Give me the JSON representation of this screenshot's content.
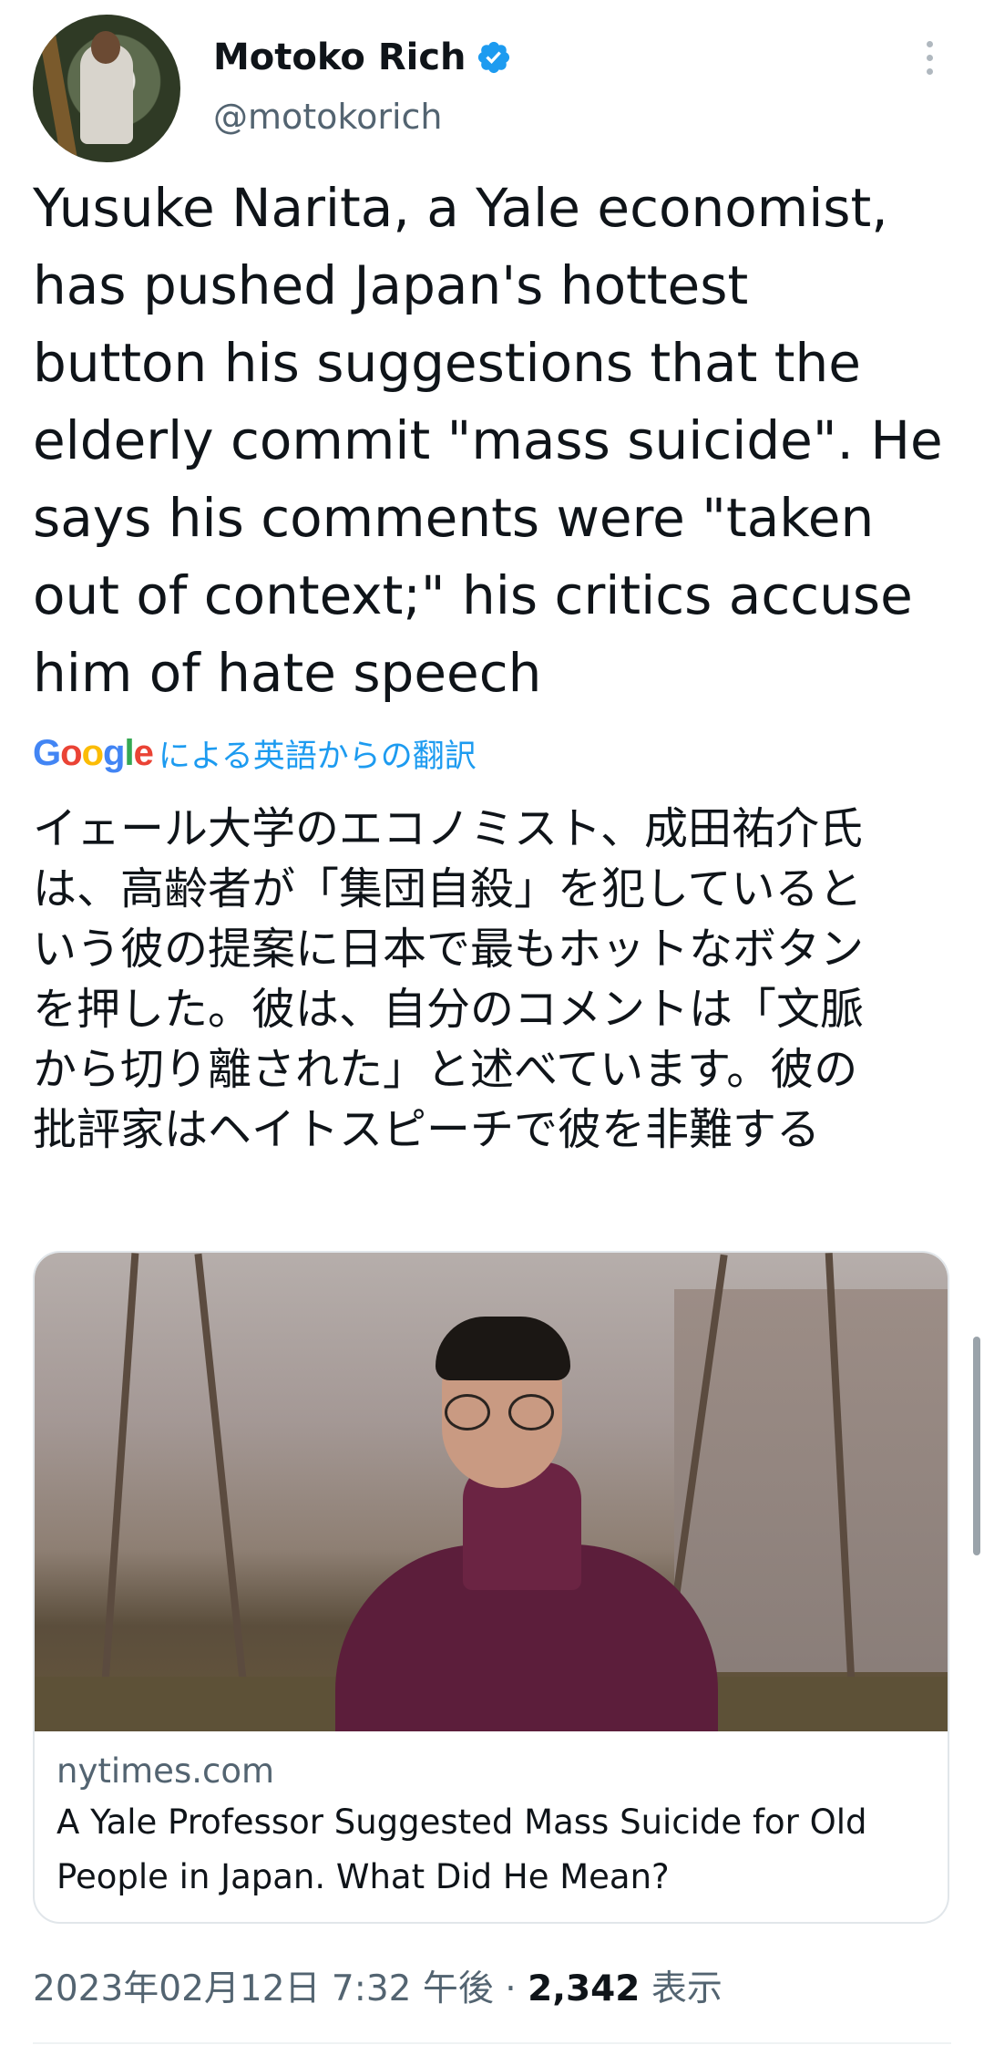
{
  "author": {
    "name": "Motoko Rich",
    "handle": "@motokorich",
    "verified": true,
    "avatar_icon": "profile-photo"
  },
  "tweet": {
    "text_lines": [
      "Yusuke Narita, a Yale economist,",
      "has pushed Japan's hottest",
      "button his suggestions that the",
      "elderly commit \"mass suicide\". He",
      "says his comments were \"taken",
      "out of context;\" his critics accuse",
      "him of hate speech"
    ]
  },
  "translation": {
    "provider_letters": [
      "G",
      "o",
      "o",
      "g",
      "l",
      "e"
    ],
    "label": "による英語からの翻訳",
    "text_lines": [
      "イェール大学のエコノミスト、成田祐介氏",
      "は、高齢者が「集団自殺」を犯していると",
      "いう彼の提案に日本で最もホットなボタン",
      "を押した。彼は、自分のコメントは「文脈",
      "から切り離された」と述べています。彼の",
      "批評家はヘイトスピーチで彼を非難する"
    ]
  },
  "link_card": {
    "domain": "nytimes.com",
    "title": "A Yale Professor Suggested Mass Suicide for Old People in Japan. What Did He Mean?"
  },
  "meta": {
    "timestamp": "2023年02月12日 7:32 午後 · ",
    "views_count": "2,342",
    "views_label": " 表示"
  },
  "colors": {
    "accent": "#1d9bf0",
    "secondary_text": "#536471",
    "primary_text": "#0f1419"
  },
  "icons": {
    "verified": "verified-badge-icon",
    "more": "more-options-icon"
  }
}
